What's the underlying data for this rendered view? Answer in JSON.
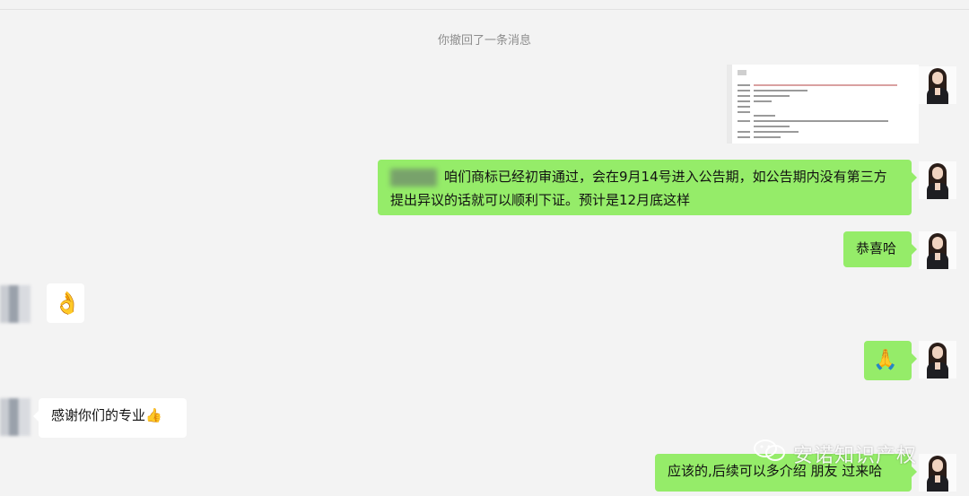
{
  "system": {
    "recall_notice": "你撤回了一条消息"
  },
  "messages": {
    "m1_text": "咱们商标已经初审通过，会在9月14号进入公告期，如公告期内没有第三方提出异议的话就可以顺利下证。预计是12月底这样",
    "m2_text": "恭喜哈",
    "m3_emoji": "👌",
    "m4_emoji": "🙏",
    "m5_text": "感谢你们的专业👍",
    "m6_text": "应该的,后续可以多介绍 朋友 过来哈"
  },
  "watermark": {
    "text": "安诺知识产权"
  },
  "colors": {
    "self_bubble": "#95ec69",
    "other_bubble": "#ffffff",
    "background": "#f3f3f3"
  }
}
